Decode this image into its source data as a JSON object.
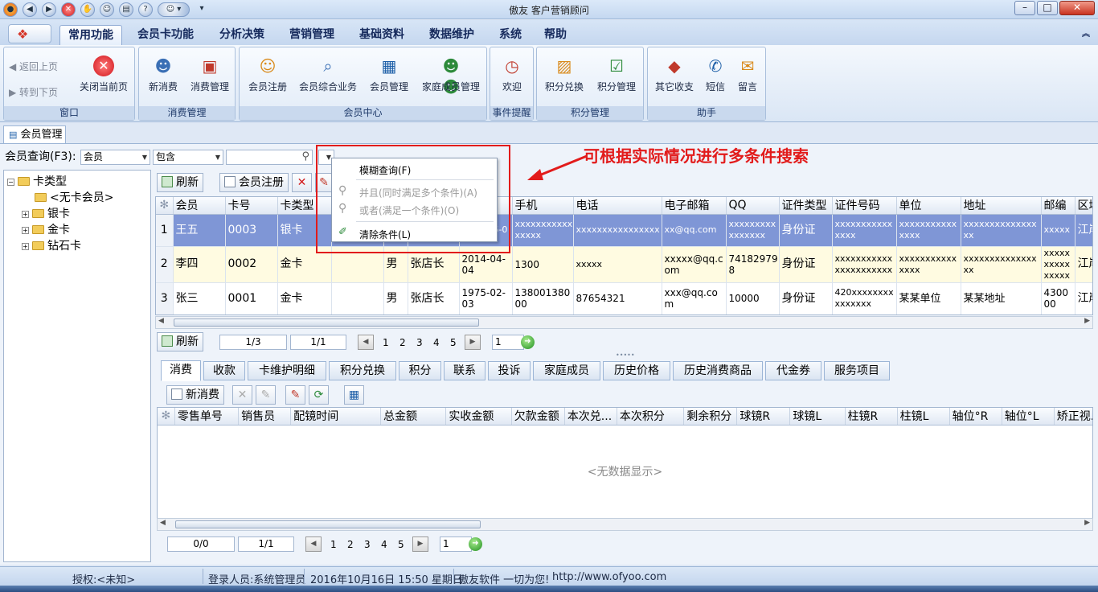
{
  "window": {
    "title": "傲友 客户营销顾问",
    "min": "–",
    "max": "□",
    "close": "✕"
  },
  "menus": [
    "常用功能",
    "会员卡功能",
    "分析决策",
    "营销管理",
    "基础资料",
    "数据维护",
    "系统",
    "帮助"
  ],
  "ribbon": {
    "groups": [
      {
        "label": "窗口",
        "buttons": [
          "返回上页",
          "转到下页",
          "关闭当前页"
        ]
      },
      {
        "label": "消费管理",
        "buttons": [
          "新消费",
          "消费管理"
        ]
      },
      {
        "label": "会员中心",
        "buttons": [
          "会员注册",
          "会员综合业务",
          "会员管理",
          "家庭成员管理"
        ]
      },
      {
        "label": "事件提醒",
        "buttons": [
          "欢迎"
        ]
      },
      {
        "label": "积分管理",
        "buttons": [
          "积分兑换",
          "积分管理"
        ]
      },
      {
        "label": "助手",
        "buttons": [
          "其它收支",
          "短信",
          "留言"
        ]
      }
    ]
  },
  "doc_tab": "会员管理",
  "search": {
    "label": "会员查询(F3):",
    "field": "会员",
    "operator": "包含",
    "value": ""
  },
  "popup": {
    "items": [
      "模糊查询(F)",
      "并且(同时满足多个条件)(A)",
      "或者(满足一个条件)(O)",
      "清除条件(L)"
    ]
  },
  "annotation": "可根据实际情况进行多条件搜索",
  "tree": {
    "root": "卡类型",
    "children": [
      "<无卡会员>",
      "银卡",
      "金卡",
      "钻石卡"
    ]
  },
  "toolbar": {
    "refresh": "刷新",
    "register": "会员注册"
  },
  "grid": {
    "columns": [
      "会员",
      "卡号",
      "卡类型",
      "",
      "",
      "",
      "",
      "手机",
      "电话",
      "电子邮箱",
      "QQ",
      "证件类型",
      "证件号码",
      "单位",
      "地址",
      "邮编",
      "区域"
    ],
    "rows": [
      [
        "1",
        "王五",
        "0003",
        "银卡",
        "",
        "",
        "",
        "2013-06-0",
        "xxxxxxxxxxxxxxxx",
        "xxxxxxxxxxxxxxxx",
        "xx@qq.com",
        "xxxxxxxxxxxxxxxx",
        "身份证",
        "xxxxxxxxxxxxxxx",
        "xxxxxxxxxxxxxxx",
        "xxxxxxxxxxxxxxxx",
        "xxxxx",
        "江岸"
      ],
      [
        "2",
        "李四",
        "0002",
        "金卡",
        "",
        "男",
        "张店长",
        "2014-04-04",
        "1300",
        "xxxxx",
        "xxxxx@qq.com",
        "741829798",
        "身份证",
        "xxxxxxxxxxxxxxxxxxxxxx",
        "xxxxxxxxxxxxxxx",
        "xxxxxxxxxxxxxxxx",
        "xxxxxxxxxxxxxxx",
        "江岸"
      ],
      [
        "3",
        "张三",
        "0001",
        "金卡",
        "",
        "男",
        "张店长",
        "1975-02-03",
        "13800138000",
        "87654321",
        "xxx@qq.com",
        "10000",
        "身份证",
        "420xxxxxxxxxxxxxxx",
        "某某单位",
        "某某地址",
        "430000",
        "江岸"
      ]
    ]
  },
  "pager1": {
    "page": "1/3",
    "sub": "1/1",
    "nums": [
      "1",
      "2",
      "3",
      "4",
      "5"
    ],
    "goto": "1"
  },
  "bottom_tabs": [
    "消费",
    "收款",
    "卡维护明细",
    "积分兑换",
    "积分",
    "联系",
    "投诉",
    "家庭成员",
    "历史价格",
    "历史消费商品",
    "代金券",
    "服务项目"
  ],
  "bottom_toolbar": {
    "new": "新消费"
  },
  "grid2": {
    "columns": [
      "零售单号",
      "销售员",
      "配镜时间",
      "总金额",
      "实收金额",
      "欠款金额",
      "本次兑...",
      "本次积分",
      "剩余积分",
      "球镜R",
      "球镜L",
      "柱镜R",
      "柱镜L",
      "轴位°R",
      "轴位°L",
      "矫正视..."
    ],
    "empty": "<无数据显示>"
  },
  "pager2": {
    "page": "0/0",
    "sub": "1/1",
    "nums": [
      "1",
      "2",
      "3",
      "4",
      "5"
    ],
    "goto": "1"
  },
  "status": {
    "auth": "授权:<未知>",
    "user": "登录人员:系统管理员",
    "datetime": "2016年10月16日 15:50 星期日",
    "slogan": "傲友软件 一切为您!",
    "url": "http://www.ofyoo.com"
  },
  "colors": {
    "accent": "#e21b1b",
    "selected_row": "#7f96d6",
    "alt_row": "#fffbe1"
  }
}
